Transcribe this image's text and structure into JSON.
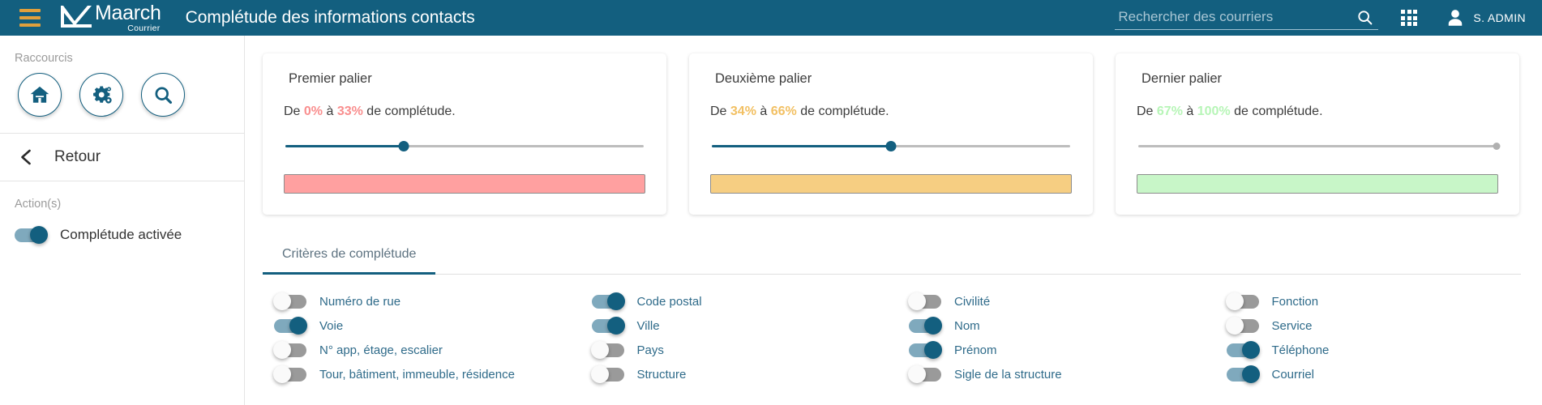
{
  "header": {
    "brand_name": "Maarch",
    "brand_sub": "Courrier",
    "page_title": "Complétude des informations contacts",
    "search_placeholder": "Rechercher des courriers",
    "search_value": "",
    "user_name": "S. ADMIN",
    "menu_icon": "hamburger-menu-icon",
    "search_icon": "search-icon",
    "apps_icon": "apps-grid-icon",
    "user_icon": "user-avatar-icon",
    "bg_color": "#135F7F",
    "accent_color": "#E2A03C"
  },
  "sidebar": {
    "shortcuts_label": "Raccourcis",
    "shortcuts": [
      {
        "name": "home-shortcut",
        "icon": "home-icon"
      },
      {
        "name": "admin-shortcut",
        "icon": "gears-icon"
      },
      {
        "name": "search-shortcut",
        "icon": "search-icon"
      }
    ],
    "back_label": "Retour",
    "back_icon": "chevron-left-icon",
    "actions_label": "Action(s)",
    "completude_toggle": {
      "label": "Complétude activée",
      "on": true
    }
  },
  "cards": [
    {
      "title": "Premier palier",
      "desc_prefix": "De ",
      "from": "0%",
      "desc_mid": " à ",
      "to": "33%",
      "desc_suffix": " de complétude.",
      "pct_color": "#F98E8E",
      "bar_color": "#FFA0A0",
      "slider_value": 33,
      "slider_disabled": false
    },
    {
      "title": "Deuxième palier",
      "desc_prefix": "De ",
      "from": "34%",
      "desc_mid": " à ",
      "to": "66%",
      "desc_suffix": " de complétude.",
      "pct_color": "#F2C063",
      "bar_color": "#F6CE82",
      "slider_value": 50,
      "slider_disabled": false
    },
    {
      "title": "Dernier palier",
      "desc_prefix": "De ",
      "from": "67%",
      "desc_mid": " à ",
      "to": "100%",
      "desc_suffix": " de complétude.",
      "pct_color": "#B7F5B7",
      "bar_color": "#C8F6C8",
      "slider_value": 100,
      "slider_disabled": true
    }
  ],
  "tabs": [
    {
      "label": "Critères de complétude",
      "active": true
    }
  ],
  "criteria": [
    {
      "label": "Numéro de rue",
      "on": false
    },
    {
      "label": "Code postal",
      "on": true
    },
    {
      "label": "Civilité",
      "on": false
    },
    {
      "label": "Fonction",
      "on": false
    },
    {
      "label": "Voie",
      "on": true
    },
    {
      "label": "Ville",
      "on": true
    },
    {
      "label": "Nom",
      "on": true
    },
    {
      "label": "Service",
      "on": false
    },
    {
      "label": "N° app, étage, escalier",
      "on": false
    },
    {
      "label": "Pays",
      "on": false
    },
    {
      "label": "Prénom",
      "on": true
    },
    {
      "label": "Téléphone",
      "on": true
    },
    {
      "label": "Tour, bâtiment, immeuble, résidence",
      "on": false
    },
    {
      "label": "Structure",
      "on": false
    },
    {
      "label": "Sigle de la structure",
      "on": false
    },
    {
      "label": "Courriel",
      "on": true
    }
  ]
}
